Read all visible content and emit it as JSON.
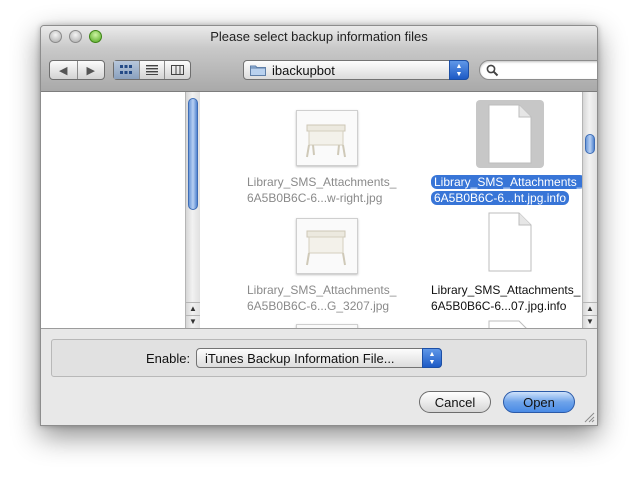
{
  "window": {
    "title": "Please select backup information files"
  },
  "toolbar": {
    "nav_back_icon": "back-arrow",
    "nav_forward_icon": "forward-arrow",
    "views": [
      {
        "icon": "icon-view",
        "selected": true
      },
      {
        "icon": "list-view",
        "selected": false
      },
      {
        "icon": "column-view",
        "selected": false
      }
    ],
    "location": "ibackupbot",
    "search": {
      "value": "",
      "placeholder": ""
    }
  },
  "files": [
    {
      "name_line1": "Library_SMS_Attachments_",
      "name_line2": "6A5B0B6C-6...w-right.jpg",
      "kind": "image",
      "enabled": false,
      "selected": false
    },
    {
      "name_line1": "Library_SMS_Attachments_",
      "name_line2": "6A5B0B6C-6...ht.jpg.info",
      "kind": "document",
      "enabled": true,
      "selected": true
    },
    {
      "name_line1": "Library_SMS_Attachments_",
      "name_line2": "6A5B0B6C-6...G_3207.jpg",
      "kind": "image",
      "enabled": false,
      "selected": false
    },
    {
      "name_line1": "Library_SMS_Attachments_",
      "name_line2": "6A5B0B6C-6...07.jpg.info",
      "kind": "document",
      "enabled": true,
      "selected": false
    }
  ],
  "enable": {
    "label": "Enable:",
    "value": "iTunes Backup Information File..."
  },
  "buttons": {
    "cancel": "Cancel",
    "open": "Open"
  },
  "colors": {
    "selection": "#3875d7",
    "default_button": "#4a8be6"
  }
}
